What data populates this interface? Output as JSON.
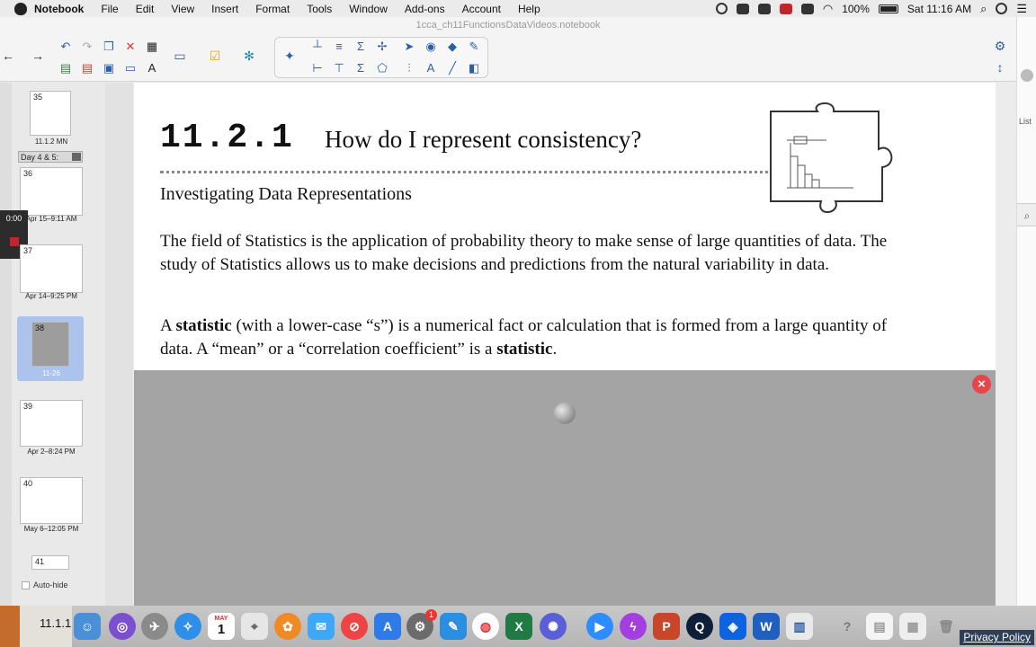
{
  "menubar": {
    "app": "Notebook",
    "items": [
      "File",
      "Edit",
      "View",
      "Insert",
      "Format",
      "Tools",
      "Window",
      "Add-ons",
      "Account",
      "Help"
    ],
    "battery": "100%",
    "clock": "Sat 11:16 AM"
  },
  "window": {
    "title": "1cca_ch11FunctionsDataVideos.notebook"
  },
  "sidebar": {
    "group_label": "Day 4 & 5:",
    "recorder_time": "0:00",
    "autohide": "Auto-hide",
    "pages": [
      {
        "num": "35",
        "caption": "11.1.2 MN"
      },
      {
        "num": "36",
        "caption": "Apr 15–9:11 AM"
      },
      {
        "num": "37",
        "caption": "Apr 14–9:25 PM"
      },
      {
        "num": "38",
        "caption": "11-26"
      },
      {
        "num": "39",
        "caption": "Apr 2–8:24 PM"
      },
      {
        "num": "40",
        "caption": "May 6–12:05 PM"
      },
      {
        "num": "41",
        "caption": ""
      }
    ]
  },
  "page": {
    "lesson_number": "11.2.1",
    "question": "How do I represent consistency?",
    "subheading": "Investigating Data Representations",
    "para1": "The field of Statistics is the application of probability theory to make sense of large quantities of data.  The study of Statistics allows us to make decisions and predictions from the natural variability in data.",
    "para2_a": "A ",
    "para2_b": "statistic",
    "para2_c": " (with a lower-case “s”) is a numerical fact or calculation that is formed from a large quantity of data.  A “mean” or a “correlation coefficient” is a ",
    "para2_d": "statistic",
    "para2_e": "."
  },
  "right_panel": {
    "list_label": "List"
  },
  "dock": {
    "partial_label": "11.1.1",
    "calendar_month": "MAY",
    "calendar_day": "1",
    "badge": "1",
    "privacy": "Privacy Policy"
  },
  "colors": {
    "accent": "#3b82f6",
    "close": "#e8454a",
    "gray_panel": "#a4a4a4"
  }
}
